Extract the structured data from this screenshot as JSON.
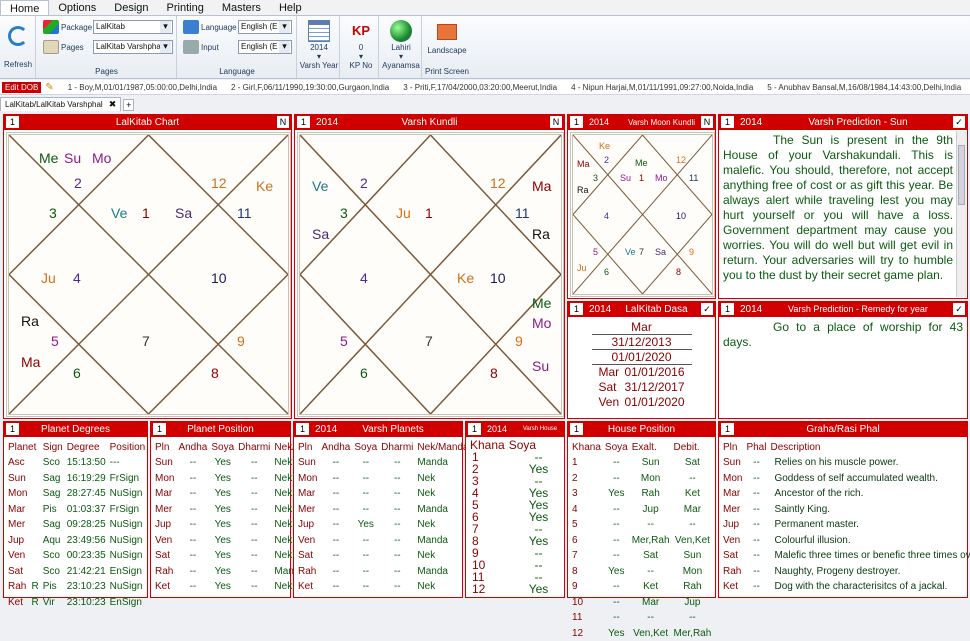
{
  "menu": [
    "Home",
    "Options",
    "Design",
    "Printing",
    "Masters",
    "Help"
  ],
  "ribbon": {
    "refresh_label": "Refresh",
    "package_label": "Package",
    "package_value": "LalKitab",
    "pages_label": "Pages",
    "pages_value": "LalKitab Varshphal",
    "pages_group": "Pages",
    "language_label": "Language",
    "language_value": "English (E",
    "input_label": "Input",
    "input_value": "English (E",
    "language_group": "Language",
    "year_value": "2014",
    "year_label": "Varsh Year",
    "kp_value": "0",
    "kp_label": "KP No",
    "ayanamsa_value": "Lahiri",
    "ayanamsa_label": "Ayanamsa",
    "landscape_label": "Landscape",
    "print_label": "Print Screen"
  },
  "dobbar": {
    "edit_label": "Edit DOB",
    "persons": [
      "1 - Boy,M,01/01/1987,05:00:00,Delhi,India",
      "2 - Girl,F,06/11/1990,19:30:00,Gurgaon,India",
      "3 - Priti,F,17/04/2000,03:20:00,Meerut,India",
      "4 - Nipun Harjai,M,01/11/1991,09:27:00,Noida,India",
      "5 - Anubhav Bansal,M,16/08/1984,14:43:00,Delhi,India"
    ]
  },
  "tab": {
    "label": "LalKitab/LalKitab Varshphal",
    "close": "✖",
    "plus": "+"
  },
  "panels": {
    "lk_chart": {
      "num": "1",
      "title": "LalKitab Chart",
      "right": "N"
    },
    "varsh_kundli": {
      "num": "1",
      "year": "2014",
      "title": "Varsh Kundli",
      "right": "N"
    },
    "moon_kundli": {
      "num": "1",
      "year": "2014",
      "title": "Varsh Moon Kundli",
      "right": "N"
    },
    "pred_sun": {
      "num": "1",
      "year": "2014",
      "title": "Varsh Prediction - Sun",
      "right": "✓"
    },
    "dasa": {
      "num": "1",
      "year": "2014",
      "title": "LalKitab Dasa",
      "right": "✓"
    },
    "pred_remedy": {
      "num": "1",
      "year": "2014",
      "title": "Varsh Prediction - Remedy for year",
      "right": "✓"
    },
    "planet_degrees": {
      "num": "1",
      "title": "Planet Degrees"
    },
    "planet_position": {
      "num": "1",
      "title": "Planet Position"
    },
    "varsh_planets": {
      "num": "1",
      "year": "2014",
      "title": "Varsh Planets"
    },
    "varsh_house": {
      "num": "1",
      "year": "2014",
      "title": "Varsh House"
    },
    "house_position": {
      "num": "1",
      "title": "House Position"
    },
    "graha_phal": {
      "num": "1",
      "title": "Graha/Rasi Phal"
    }
  },
  "lk_chart": {
    "houses": [
      {
        "h": "1",
        "n": "2",
        "n2": "1"
      },
      {
        "label": "2",
        "planets": "Me Su Mo"
      }
    ],
    "nums": [
      "2",
      "12",
      "3",
      "1",
      "11",
      "4",
      "10",
      "5",
      "7",
      "9",
      "6",
      "8"
    ],
    "planets": {
      "h1": "Ve",
      "h1b": "Sa",
      "h2a": "Me",
      "h2b": "Su",
      "h2c": "Mo",
      "h12": "Ke",
      "h4": "Ju",
      "h5": "Ra",
      "h6": "Ma"
    }
  },
  "varsh_kundli": {
    "nums": [
      "2",
      "12",
      "3",
      "1",
      "11",
      "4",
      "10",
      "5",
      "7",
      "9",
      "6",
      "8"
    ],
    "planets": {
      "h3a": "Ve",
      "h3b": "Sa",
      "h1": "Ju",
      "h12": "Ma",
      "h11": "Ra",
      "h10": "Ke",
      "h9a": "Me",
      "h9b": "Mo",
      "h8": "Su"
    }
  },
  "moon_kundli": {
    "nums": [
      "2",
      "12",
      "3",
      "1",
      "11",
      "4",
      "10",
      "5",
      "7",
      "9",
      "6",
      "8"
    ],
    "planets": {
      "h2a": "Ke",
      "h3a": "Ma",
      "h3b": "Ra",
      "h1a": "Me",
      "h1b": "Su",
      "h1c": "Mo",
      "h7a": "Ve",
      "h7b": "Sa",
      "h5": "Ju"
    }
  },
  "pred_sun_text": "The Sun is present in the 9th House of your Varshakundali. This is malefic. You should, therefore, not accept anything free of cost or as gift this year. Be always alert while traveling lest you may hurt yourself or you will have a loss. Government department may cause you worries. You will do well but will get evil in return. Your adversaries will try to humble you to the dust by their secret game plan.",
  "pred_remedy_text": "Go to a place of worship for 43 days.",
  "dasa": {
    "rows": [
      {
        "p": "",
        "d": "Mar"
      },
      {
        "p": "",
        "d": "31/12/2013"
      },
      {
        "p": "",
        "d": "01/01/2020"
      },
      {
        "p": "Mar",
        "d": "01/01/2016"
      },
      {
        "p": "Sat",
        "d": "31/12/2017"
      },
      {
        "p": "Ven",
        "d": "01/01/2020"
      }
    ]
  },
  "planet_degrees": {
    "headers": [
      "Planet",
      "Sign",
      "Degree",
      "Position"
    ],
    "rows": [
      [
        "Asc",
        "",
        "Sco",
        "15:13:50",
        "---"
      ],
      [
        "Sun",
        "",
        "Sag",
        "16:19:29",
        "FrSign"
      ],
      [
        "Mon",
        "",
        "Sag",
        "28:27:45",
        "NuSign"
      ],
      [
        "Mar",
        "",
        "Pis",
        "01:03:37",
        "FrSign"
      ],
      [
        "Mer",
        "",
        "Sag",
        "09:28:25",
        "NuSign"
      ],
      [
        "Jup",
        "",
        "Aqu",
        "23:49:56",
        "NuSign"
      ],
      [
        "Ven",
        "",
        "Sco",
        "00:23:35",
        "NuSign"
      ],
      [
        "Sat",
        "",
        "Sco",
        "21:42:21",
        "EnSign"
      ],
      [
        "Rah",
        "R",
        "Pis",
        "23:10:23",
        "NuSign"
      ],
      [
        "Ket",
        "R",
        "Vir",
        "23:10:23",
        "EnSign"
      ]
    ]
  },
  "planet_position": {
    "headers": [
      "Pln",
      "Andha",
      "Soya",
      "Dharmi",
      "Nek/Manda"
    ],
    "rows": [
      [
        "Sun",
        "--",
        "Yes",
        "--",
        "Nek"
      ],
      [
        "Mon",
        "--",
        "Yes",
        "--",
        "Nek"
      ],
      [
        "Mar",
        "--",
        "Yes",
        "--",
        "Nek"
      ],
      [
        "Mer",
        "--",
        "Yes",
        "--",
        "Nek"
      ],
      [
        "Jup",
        "--",
        "Yes",
        "--",
        "Nek"
      ],
      [
        "Ven",
        "--",
        "Yes",
        "--",
        "Nek"
      ],
      [
        "Sat",
        "--",
        "Yes",
        "--",
        "Nek"
      ],
      [
        "Rah",
        "--",
        "Yes",
        "--",
        "Manda"
      ],
      [
        "Ket",
        "--",
        "Yes",
        "--",
        "Nek"
      ]
    ]
  },
  "varsh_planets": {
    "headers": [
      "Pln",
      "Andha",
      "Soya",
      "Dharmi",
      "Nek/Manda"
    ],
    "rows": [
      [
        "Sun",
        "--",
        "--",
        "--",
        "Manda"
      ],
      [
        "Mon",
        "--",
        "--",
        "--",
        "Nek"
      ],
      [
        "Mar",
        "--",
        "--",
        "--",
        "Nek"
      ],
      [
        "Mer",
        "--",
        "--",
        "--",
        "Manda"
      ],
      [
        "Jup",
        "--",
        "Yes",
        "--",
        "Nek"
      ],
      [
        "Ven",
        "--",
        "--",
        "--",
        "Manda"
      ],
      [
        "Sat",
        "--",
        "--",
        "--",
        "Nek"
      ],
      [
        "Rah",
        "--",
        "--",
        "--",
        "Manda"
      ],
      [
        "Ket",
        "--",
        "--",
        "--",
        "Nek"
      ]
    ]
  },
  "varsh_house": {
    "headers": [
      "Khana",
      "Soya"
    ],
    "rows": [
      [
        "1",
        "--"
      ],
      [
        "2",
        "Yes"
      ],
      [
        "3",
        "--"
      ],
      [
        "4",
        "Yes"
      ],
      [
        "5",
        "Yes"
      ],
      [
        "6",
        "Yes"
      ],
      [
        "7",
        "--"
      ],
      [
        "8",
        "Yes"
      ],
      [
        "9",
        "--"
      ],
      [
        "10",
        "--"
      ],
      [
        "11",
        "--"
      ],
      [
        "12",
        "Yes"
      ]
    ]
  },
  "house_position": {
    "headers": [
      "Khana",
      "Soya",
      "Exalt.",
      "Debit."
    ],
    "rows": [
      [
        "1",
        "--",
        "Sun",
        "Sat"
      ],
      [
        "2",
        "--",
        "Mon",
        "--"
      ],
      [
        "3",
        "Yes",
        "Rah",
        "Ket"
      ],
      [
        "4",
        "--",
        "Jup",
        "Mar"
      ],
      [
        "5",
        "--",
        "--",
        "--"
      ],
      [
        "6",
        "--",
        "Mer,Rah",
        "Ven,Ket"
      ],
      [
        "7",
        "--",
        "Sat",
        "Sun"
      ],
      [
        "8",
        "Yes",
        "--",
        "Mon"
      ],
      [
        "9",
        "--",
        "Ket",
        "Rah"
      ],
      [
        "10",
        "--",
        "Mar",
        "Jup"
      ],
      [
        "11",
        "--",
        "--",
        "--"
      ],
      [
        "12",
        "Yes",
        "Ven,Ket",
        "Mer,Rah"
      ]
    ]
  },
  "graha_phal": {
    "headers": [
      "Pln",
      "Phal",
      "Description"
    ],
    "rows": [
      [
        "Sun",
        "--",
        "Relies on his muscle power."
      ],
      [
        "Mon",
        "--",
        "Goddess of self accumulated wealth."
      ],
      [
        "Mar",
        "--",
        "Ancestor of the rich."
      ],
      [
        "Mer",
        "--",
        "Saintly King."
      ],
      [
        "Jup",
        "--",
        "Permanent master."
      ],
      [
        "Ven",
        "--",
        "Colourful illusion."
      ],
      [
        "Sat",
        "--",
        "Malefic three times or benefic three times over."
      ],
      [
        "Rah",
        "--",
        "Naughty, Progeny destroyer."
      ],
      [
        "Ket",
        "--",
        "Dog with the characterisitcs of a jackal."
      ]
    ]
  },
  "colors": {
    "accent": "#d00000",
    "text_green": "#0b5a10",
    "text_red": "#8b0000"
  }
}
